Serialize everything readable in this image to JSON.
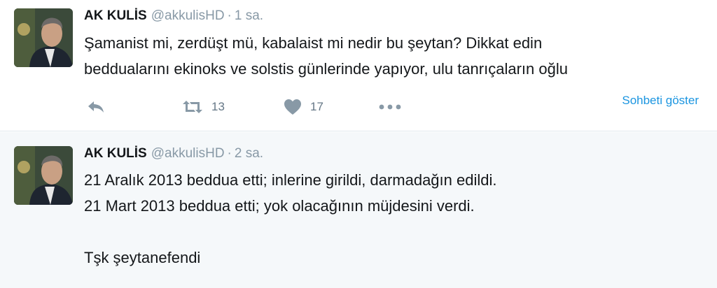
{
  "tweets": [
    {
      "name": "AK KULİS",
      "handle": "@akkulisHD",
      "separator": "·",
      "time": "1 sa.",
      "lines": [
        "Şamanist mi, zerdüşt mü, kabalaist mi nedir bu şeytan? Dikkat edin",
        "bedduaları​nı ekinoks ve solstis günlerinde yapıyor, ulu tanrıçaların oğlu"
      ],
      "actions": {
        "reply_icon": "reply-icon",
        "retweet_icon": "retweet-icon",
        "retweet_count": "13",
        "like_icon": "heart-icon",
        "like_count": "17",
        "more_icon": "more-dots-icon"
      },
      "show_conversation": "Sohbeti göster"
    },
    {
      "name": "AK KULİS",
      "handle": "@akkulisHD",
      "separator": "·",
      "time": "2 sa.",
      "lines": [
        "21 Aralık 2013 beddua etti; inlerine girildi, darmadağın edildi.",
        "21 Mart 2013 beddua etti; yok olacağının müjdesini verdi.",
        "",
        "Tşk şeytanefendi"
      ]
    }
  ],
  "colors": {
    "link": "#1b95e0",
    "muted": "#8899a6",
    "text": "#14171a",
    "highlight_bg": "#f5f8fa",
    "divider": "#e1e8ed"
  }
}
